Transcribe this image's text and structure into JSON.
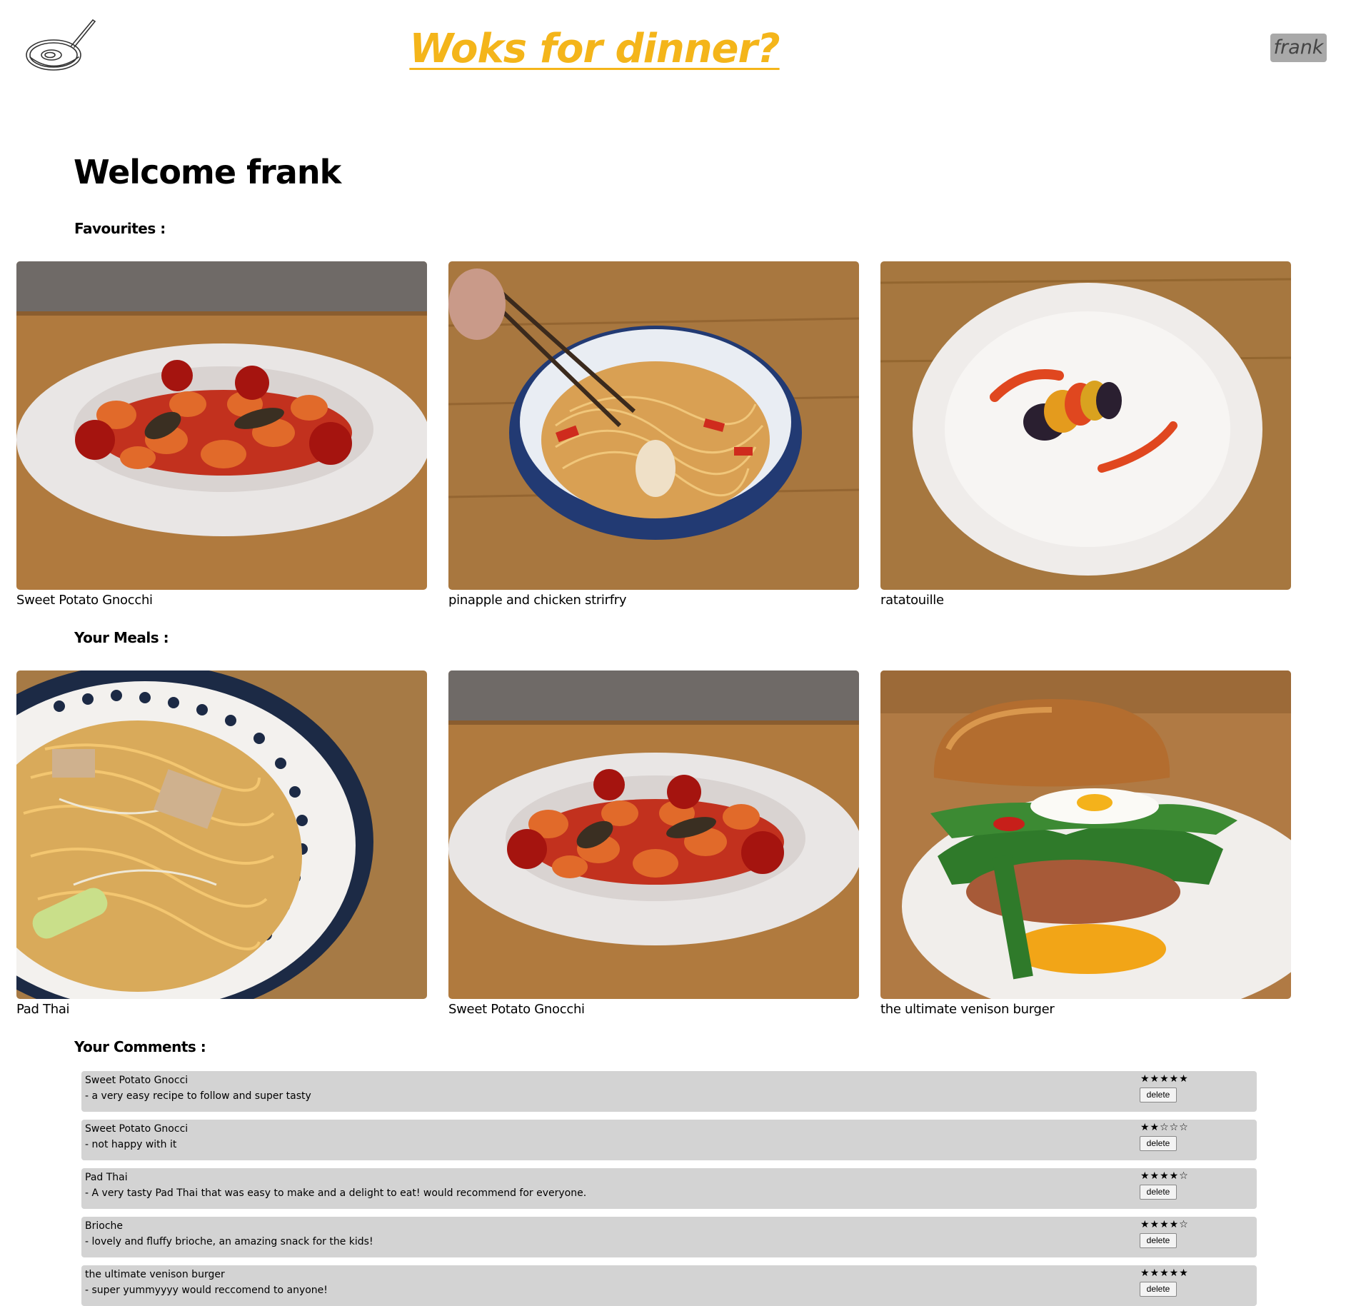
{
  "header": {
    "site_title": "Woks for dinner?",
    "user_label": "frank",
    "accent_color": "#f4b51a"
  },
  "welcome": "Welcome frank",
  "sections": {
    "favourites": "Favourites :",
    "meals": "Your Meals :",
    "comments": "Your Comments :"
  },
  "favourites": [
    {
      "name": "Sweet Potato Gnocchi",
      "image": "gnocchi-photo"
    },
    {
      "name": "pinapple and chicken strirfry",
      "image": "stirfry-photo"
    },
    {
      "name": "ratatouille",
      "image": "ratatouille-photo"
    }
  ],
  "meals": [
    {
      "name": "Pad Thai",
      "image": "pad-thai-photo"
    },
    {
      "name": "Sweet Potato Gnocchi",
      "image": "gnocchi-photo"
    },
    {
      "name": "the ultimate venison burger",
      "image": "burger-photo"
    }
  ],
  "comments": [
    {
      "recipe": "Sweet Potato Gnocci",
      "text": "- a very easy recipe to follow and super tasty",
      "stars": "★★★★★",
      "rating": 5,
      "delete_label": "delete"
    },
    {
      "recipe": "Sweet Potato Gnocci",
      "text": "- not happy with it",
      "stars": "★★☆☆☆",
      "rating": 2,
      "delete_label": "delete"
    },
    {
      "recipe": "Pad Thai",
      "text": "- A very tasty Pad Thai that was easy to make and a delight to eat! would recommend for everyone.",
      "stars": "★★★★☆",
      "rating": 4,
      "delete_label": "delete"
    },
    {
      "recipe": "Brioche",
      "text": "- lovely and fluffy brioche, an amazing snack for the kids!",
      "stars": "★★★★☆",
      "rating": 4,
      "delete_label": "delete"
    },
    {
      "recipe": "the ultimate venison burger",
      "text": "- super yummyyyy would reccomend to anyone!",
      "stars": "★★★★★",
      "rating": 5,
      "delete_label": "delete"
    }
  ]
}
